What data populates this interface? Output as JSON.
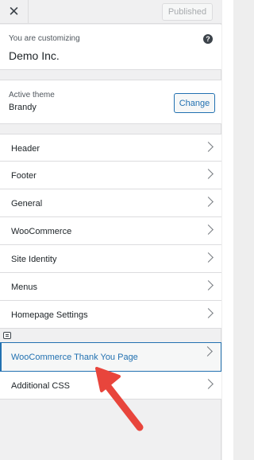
{
  "topbar": {
    "close_glyph": "✕",
    "publish_label": "Published"
  },
  "info": {
    "customizing_label": "You are customizing",
    "site_title": "Demo Inc.",
    "help_glyph": "?"
  },
  "theme": {
    "active_label": "Active theme",
    "name": "Brandy",
    "change_label": "Change"
  },
  "menu": {
    "items": [
      {
        "label": "Header"
      },
      {
        "label": "Footer"
      },
      {
        "label": "General"
      },
      {
        "label": "WooCommerce"
      },
      {
        "label": "Site Identity"
      },
      {
        "label": "Menus"
      },
      {
        "label": "Homepage Settings"
      }
    ],
    "active_item": {
      "label": "WooCommerce Thank You Page"
    },
    "last_item": {
      "label": "Additional CSS"
    }
  },
  "colors": {
    "accent": "#2271b1",
    "arrow": "#e8453c"
  },
  "icons": [
    "close-icon",
    "help-icon",
    "chevron-right-icon",
    "shortcut-edit-icon",
    "pointer-arrow-icon"
  ]
}
